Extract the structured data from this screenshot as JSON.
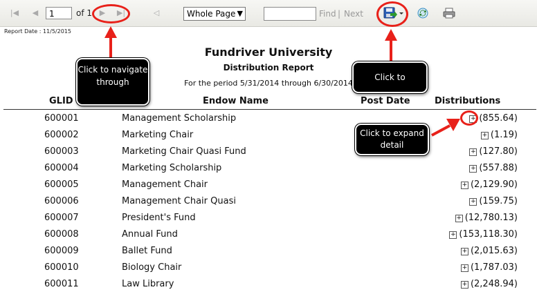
{
  "toolbar": {
    "page_value": "1",
    "page_of": "of 1",
    "zoom_selected": "Whole Page",
    "find_label": "Find",
    "next_label": "Next"
  },
  "report": {
    "date": "Report Date : 11/5/2015",
    "org": "Fundriver University",
    "title": "Distribution Report",
    "period": "For the period 5/31/2014 through 6/30/2014"
  },
  "table": {
    "headers": [
      "GLID",
      "Endow Name",
      "Post Date",
      "Distributions"
    ],
    "rows": [
      {
        "glid": "600001",
        "name": "Management Scholarship",
        "dist": "(855.64)"
      },
      {
        "glid": "600002",
        "name": "Marketing Chair",
        "dist": "(1.19)"
      },
      {
        "glid": "600003",
        "name": "Marketing Chair Quasi Fund",
        "dist": "(127.80)"
      },
      {
        "glid": "600004",
        "name": "Marketing Scholarship",
        "dist": "(557.88)"
      },
      {
        "glid": "600005",
        "name": "Management Chair",
        "dist": "(2,129.90)"
      },
      {
        "glid": "600006",
        "name": "Management Chair Quasi",
        "dist": "(159.75)"
      },
      {
        "glid": "600007",
        "name": "President's Fund",
        "dist": "(12,780.13)"
      },
      {
        "glid": "600008",
        "name": "Annual Fund",
        "dist": "(153,118.30)"
      },
      {
        "glid": "600009",
        "name": "Ballet Fund",
        "dist": "(2,015.63)"
      },
      {
        "glid": "600010",
        "name": "Biology Chair",
        "dist": "(1,787.03)"
      },
      {
        "glid": "600011",
        "name": "Law Library",
        "dist": "(2,248.94)"
      }
    ]
  },
  "callouts": {
    "navigate": "Click to navigate through",
    "export": "Click to",
    "expand": "Click to expand detail"
  },
  "icons": [
    "first-page-icon",
    "previous-page-icon",
    "next-page-icon",
    "last-page-icon",
    "back-icon",
    "export-save-icon",
    "refresh-icon",
    "print-icon",
    "expand-plus-icon"
  ],
  "colors": {
    "annotation_red": "#e8211a",
    "callout_bg": "#000000",
    "toolbar_bg": "#efefea"
  }
}
